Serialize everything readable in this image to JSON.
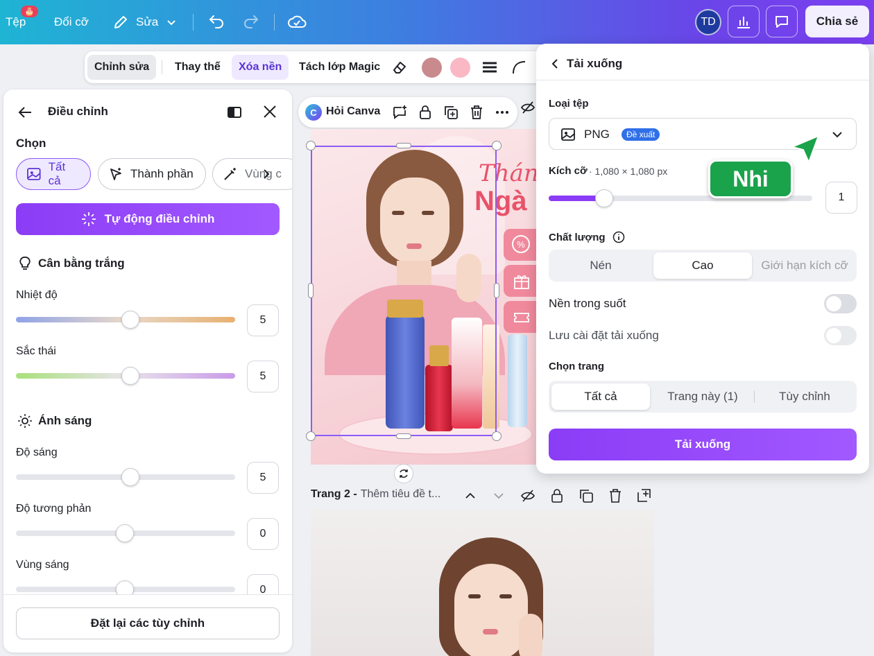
{
  "topbar": {
    "file_label": "Tệp",
    "file_badge": "🎂",
    "resize_label": "Đổi cỡ",
    "edit_label": "Sửa",
    "avatar_initials": "TD",
    "share_label": "Chia sẻ"
  },
  "context_toolbar": {
    "edit": "Chỉnh sửa",
    "replace": "Thay thế",
    "remove_bg": "Xóa nền",
    "magic_grab": "Tách lớp Magic",
    "swatch_1": "#c98a8e",
    "swatch_2": "#f9b8c4"
  },
  "adjust_panel": {
    "title": "Điều chỉnh",
    "select_label": "Chọn",
    "chips": [
      "Tất cả",
      "Thành phần",
      "Vùng c"
    ],
    "auto_adjust": "Tự động điều chỉnh",
    "white_balance": {
      "heading": "Cân bằng trắng",
      "temperature": {
        "label": "Nhiệt độ",
        "value": "5"
      },
      "tint": {
        "label": "Sắc thái",
        "value": "5"
      }
    },
    "light": {
      "heading": "Ánh sáng",
      "brightness": {
        "label": "Độ sáng",
        "value": "5"
      },
      "contrast": {
        "label": "Độ tương phản",
        "value": "0"
      },
      "highlights": {
        "label": "Vùng sáng",
        "value": "0"
      }
    },
    "reset": "Đặt lại các tùy chỉnh"
  },
  "canvas": {
    "ask_canva": "Hỏi Canva",
    "page1_text_1": "Tháng",
    "page1_text_2": "Ngà",
    "page2_title": "Trang 2 -",
    "page2_subtitle": "Thêm tiêu đề t..."
  },
  "download_panel": {
    "title": "Tải xuống",
    "file_type_label": "Loại tệp",
    "file_type_value": "PNG",
    "recommended_badge": "Đề xuất",
    "size_label": "Kích cỡ",
    "size_dims": "· 1,080 × 1,080 px",
    "size_value": "1",
    "size_fraction": 0.21,
    "quality_label": "Chất lượng",
    "quality_options": [
      "Nén",
      "Cao",
      "Giới hạn kích cỡ"
    ],
    "transparent_bg": "Nền trong suốt",
    "save_settings": "Lưu cài đặt tải xuống",
    "select_pages_label": "Chọn trang",
    "page_options": [
      "Tất cả",
      "Trang này (1)",
      "Tùy chỉnh"
    ],
    "download_button": "Tải xuống"
  },
  "cursor_tag": "Nhi"
}
